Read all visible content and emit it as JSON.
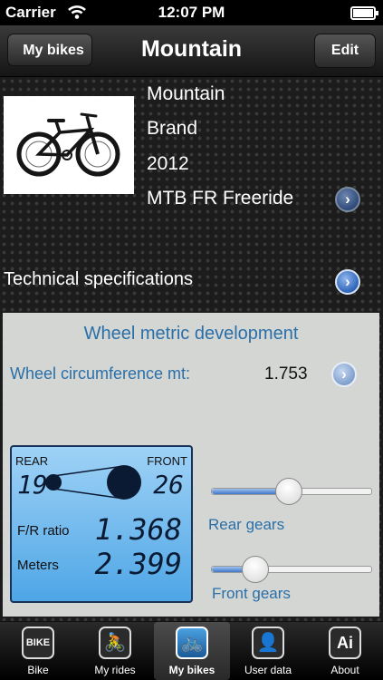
{
  "status_bar": {
    "carrier": "Carrier",
    "time": "12:07 PM",
    "wifi_icon": "wifi-icon",
    "battery_icon": "battery-icon"
  },
  "nav": {
    "back_label": "My bikes",
    "title": "Mountain",
    "edit_label": "Edit"
  },
  "bike": {
    "name": "Mountain",
    "brand": "Brand",
    "year": "2012",
    "category": "MTB FR Freeride",
    "photo": "mountain-bike-photo"
  },
  "tech_specs_label": "Technical specifications",
  "wheel": {
    "title": "Wheel metric development",
    "circumference_label": "Wheel circumference mt:",
    "circumference_value": "1.753"
  },
  "lcd": {
    "rear_label": "REAR",
    "front_label": "FRONT",
    "rear_value": "19",
    "front_value": "26",
    "ratio_label": "F/R ratio",
    "ratio_value": "1.368",
    "meters_label": "Meters",
    "meters_value": "2.399"
  },
  "sliders": {
    "rear_label": "Rear gears",
    "rear_level": 0.47,
    "front_label": "Front gears",
    "front_level": 0.22
  },
  "tabs": [
    {
      "label": "Bike",
      "icon": "bike-logo-icon",
      "glyph": "BIKE",
      "active": false
    },
    {
      "label": "My rides",
      "icon": "cyclist-icon",
      "glyph": "🚴",
      "active": false
    },
    {
      "label": "My bikes",
      "icon": "bicycle-icon",
      "glyph": "🚲",
      "active": true
    },
    {
      "label": "User data",
      "icon": "user-icon",
      "glyph": "👤",
      "active": false
    },
    {
      "label": "About",
      "icon": "ai-logo-icon",
      "glyph": "Ai",
      "active": false
    }
  ],
  "colors": {
    "accent_blue": "#2a6fa8",
    "panel_bg": "#d4d6d4",
    "lcd_top": "#9fd2f6",
    "lcd_bottom": "#4ea6e6"
  }
}
